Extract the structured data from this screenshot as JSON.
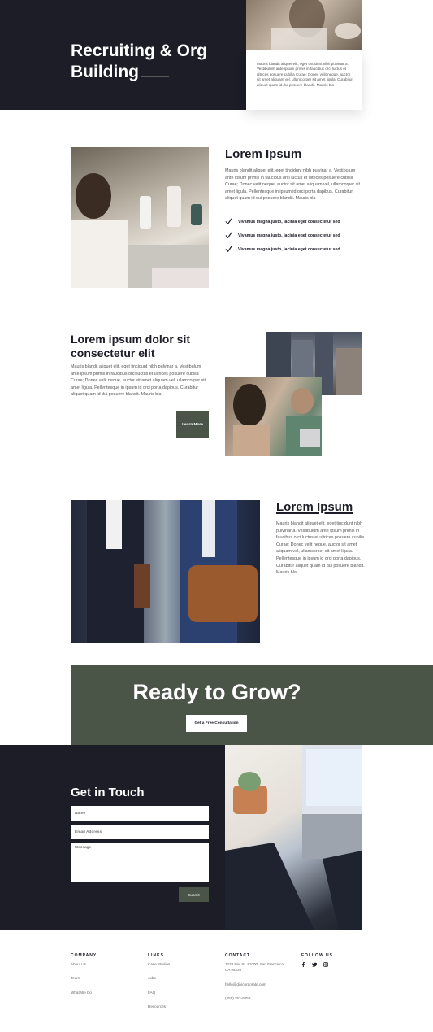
{
  "colors": {
    "dark": "#1d1d28",
    "accent": "#4a5548",
    "white": "#ffffff",
    "text": "#555555"
  },
  "hero": {
    "title_line1": "Recruiting & Org",
    "title_line2": "Building",
    "card_text": "Mauris blandit aliquet elit, eget tincidunt nibh pulvinar a. Vestibulum ante ipsum primis in faucibus orci luctus et ultrices posuere cubilia Curae; Donec velit neque, auctor sit amet aliquam vel, ullamcorper sit amet ligula. Curabitur aliquet quam id dui posuere blandit. Mauris bla"
  },
  "section1": {
    "title": "Lorem Ipsum",
    "body": "Mauris blandit aliquet elit, eget tincidunt nibh pulvinar a. Vestibulum ante ipsum primis in faucibus orci luctus et ultrices posuere cubilia Curae; Donec velit neque, auctor sit amet aliquam vel, ullamcorper sit amet ligula. Pellentesque in ipsum id orci porta dapibus. Curabitur aliquet quam id dui posuere blandit. Mauris bla",
    "checks": [
      "Vivamus magna justo, lacinia eget consectetur sed",
      "Vivamus magna justo, lacinia eget consectetur sed",
      "Vivamus magna justo, lacinia eget consectetur sed"
    ]
  },
  "section2": {
    "title": "Lorem ipsum dolor sit consectetur elit",
    "body": "Mauris blandit aliquet elit, eget tincidunt nibh pulvinar a. Vestibulum ante ipsum primis in faucibus orci luctus et ultrices posuere cubilia Curae; Donec velit neque, auctor sit amet aliquam vel, ullamcorper sit amet ligula. Pellentesque in ipsum id orci porta dapibus. Curabitur aliquet quam id dui posuere blandit. Mauris bla",
    "button": "Learn More"
  },
  "section3": {
    "title": "Lorem Ipsum",
    "body": "Mauris blandit aliquet elit, eget tincidunt nibh pulvinar a. Vestibulum ante ipsum primis in faucibus orci luctus et ultrices posuere cubilia Curae; Donec velit neque, auctor sit amet aliquam vel, ullamcorper sit amet ligula. Pellentesque in ipsum id orci porta dapibus. Curabitur aliquet quam id dui posuere blandit. Mauris bla"
  },
  "cta": {
    "title": "Ready to Grow?",
    "button": "Get a Free Consultation"
  },
  "contact": {
    "title": "Get in Touch",
    "name_placeholder": "Name",
    "email_placeholder": "Email Address",
    "message_placeholder": "Message",
    "submit": "Submit"
  },
  "footer": {
    "company": {
      "heading": "COMPANY",
      "links": [
        "About Us",
        "Team",
        "What We Do"
      ]
    },
    "links": {
      "heading": "LINKS",
      "links": [
        "Case Studies",
        "Jobs",
        "FAQ",
        "Resources"
      ]
    },
    "contact": {
      "heading": "CONTACT",
      "address": "1234 Divi St. #1000, San Francisco, CA 94220",
      "email": "hello@divicorporate.com",
      "phone": "(255) 352-6258"
    },
    "follow": {
      "heading": "FOLLOW US",
      "icons": [
        "facebook-icon",
        "twitter-icon",
        "instagram-icon"
      ]
    }
  }
}
